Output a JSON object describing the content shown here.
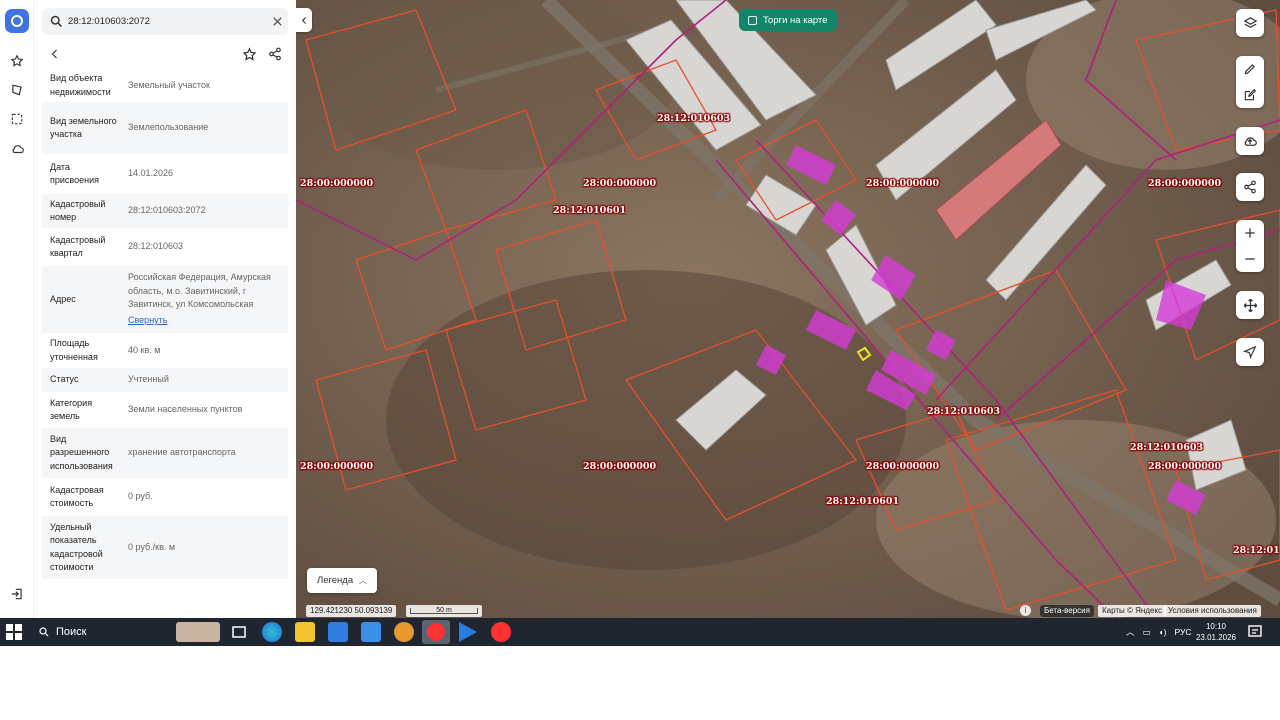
{
  "search": {
    "value": "28:12:010603:2072"
  },
  "card": {
    "rows": [
      {
        "label": "Вид объекта недвижимости",
        "value": "Земельный участок"
      },
      {
        "label": "Вид земельного участка",
        "value": "Землепользование"
      },
      {
        "label": "Дата присвоения",
        "value": "14.01.2026"
      },
      {
        "label": "Кадастровый номер",
        "value": "28:12:010603:2072"
      },
      {
        "label": "Кадастровый квартал",
        "value": "28:12:010603"
      },
      {
        "label": "Адрес",
        "value": "Российская Федерация, Амурская область, м.о. Завитинский, г Завитинск, ул Комсомольская",
        "link": "Свернуть"
      },
      {
        "label": "Площадь уточненная",
        "value": "40 кв. м"
      },
      {
        "label": "Статус",
        "value": "Учтенный"
      },
      {
        "label": "Категория земель",
        "value": "Земли населенных пунктов"
      },
      {
        "label": "Вид разрешенного использования",
        "value": "хранение автотранспорта"
      },
      {
        "label": "Кадастровая стоимость",
        "value": "0 руб."
      },
      {
        "label": "Удельный показатель кадастровой стоимости",
        "value": "0 руб./кв. м"
      }
    ]
  },
  "map": {
    "torgi_label": "Торги на карте",
    "legend_label": "Легенда",
    "coordinates": "129.421230   50.093139",
    "scale_label": "50 m",
    "beta_label": "Бета-версия",
    "attribution": "Карты © Яндекс",
    "terms": "Условия использования",
    "cadastral_labels": [
      "28:12:010603",
      "28:00:000000",
      "28:00:000000",
      "28:12:010601",
      "28:00:000000",
      "28:00:000000",
      "28:12:010603",
      "28:00:000000",
      "28:00:000000",
      "28:00:000000",
      "28:12:010603",
      "28:00:000000",
      "28:12:010601",
      "28:12:01"
    ]
  },
  "taskbar": {
    "search_label": "Поиск",
    "lang": "РУС",
    "time": "10:10",
    "date": "23.01.2026"
  },
  "colors": {
    "accent": "#3e74e6",
    "torgi_bg": "#12866a",
    "parcel_stroke": "#e8502a",
    "zone_stroke": "#b0207c",
    "highlight": "#d63bd8",
    "selected": "#f2e21a"
  }
}
